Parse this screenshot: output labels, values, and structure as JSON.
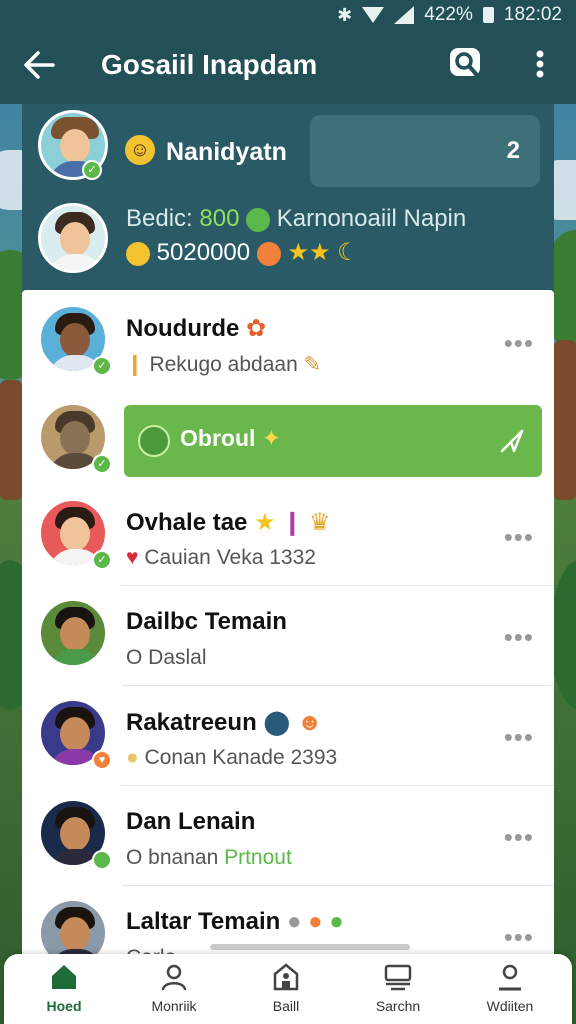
{
  "status_bar": {
    "battery": "422%",
    "time": "182:02"
  },
  "app_bar": {
    "title": "Gosaiil Inapdam"
  },
  "header": {
    "name": "Nanidyatn",
    "badge_count": "2",
    "line1_prefix": "Bedic:",
    "line1_value": "800",
    "line1_suffix": "Karnonoaiil Napin",
    "line2": "5020000"
  },
  "highlight": {
    "label": "Obroul"
  },
  "contacts": [
    {
      "name": "Noudurde",
      "subtitle": "Rekugo abdaan"
    },
    {
      "name": "Ovhale tae",
      "subtitle": "Cauian Veka 1332"
    },
    {
      "name": "Dailbc Temain",
      "subtitle": "O Daslal"
    },
    {
      "name": "Rakatreeun",
      "subtitle": "Conan Kanade 2393"
    },
    {
      "name": "Dan Lenain",
      "subtitle_prefix": "O bnanan",
      "subtitle_highlight": "Prtnout"
    },
    {
      "name": "Laltar Temain",
      "subtitle": "Carlo"
    }
  ],
  "bottom_nav": {
    "items": [
      {
        "label": "Hoed",
        "icon": "home-icon"
      },
      {
        "label": "Monriik",
        "icon": "person-icon"
      },
      {
        "label": "Baill",
        "icon": "building-icon"
      },
      {
        "label": "Sarchn",
        "icon": "inbox-icon"
      },
      {
        "label": "Wdiiten",
        "icon": "profile-icon"
      }
    ]
  },
  "colors": {
    "appbar": "#234f57",
    "accent_green": "#6ab84c",
    "nav_active": "#1f6b3a"
  }
}
